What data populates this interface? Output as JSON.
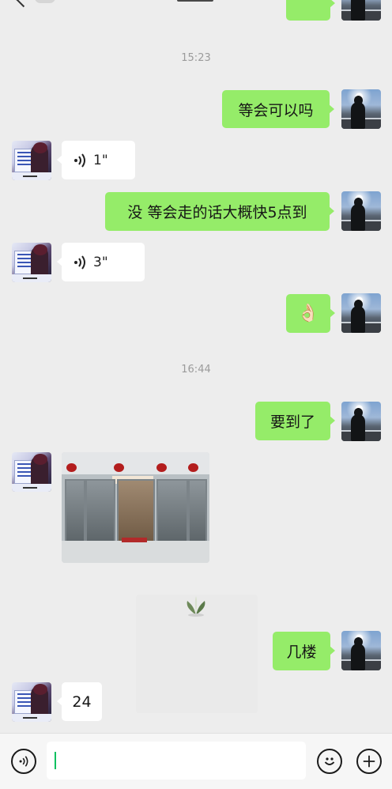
{
  "conversation": {
    "timestamps": [
      "15:23",
      "16:44"
    ],
    "messages": [
      {
        "type": "text",
        "from": "me",
        "text": "等会可以吗"
      },
      {
        "type": "voice",
        "from": "other",
        "duration": "1\""
      },
      {
        "type": "text",
        "from": "me",
        "text": "没 等会走的话大概快5点到"
      },
      {
        "type": "voice",
        "from": "other",
        "duration": "3\""
      },
      {
        "type": "emoji",
        "from": "me",
        "text": "👌🏻"
      },
      {
        "type": "text",
        "from": "me",
        "text": "要到了"
      },
      {
        "type": "image",
        "from": "other"
      },
      {
        "type": "text",
        "from": "me",
        "text": "几楼"
      },
      {
        "type": "text",
        "from": "other",
        "text": "24"
      }
    ]
  },
  "input_bar": {
    "voice_icon": "voice-toggle-icon",
    "emoji_icon": "emoji-icon",
    "plus_icon": "plus-icon",
    "text_value": ""
  },
  "colors": {
    "sent_bubble": "#95ec69",
    "received_bubble": "#ffffff",
    "background": "#ededed",
    "caret": "#07c160"
  }
}
